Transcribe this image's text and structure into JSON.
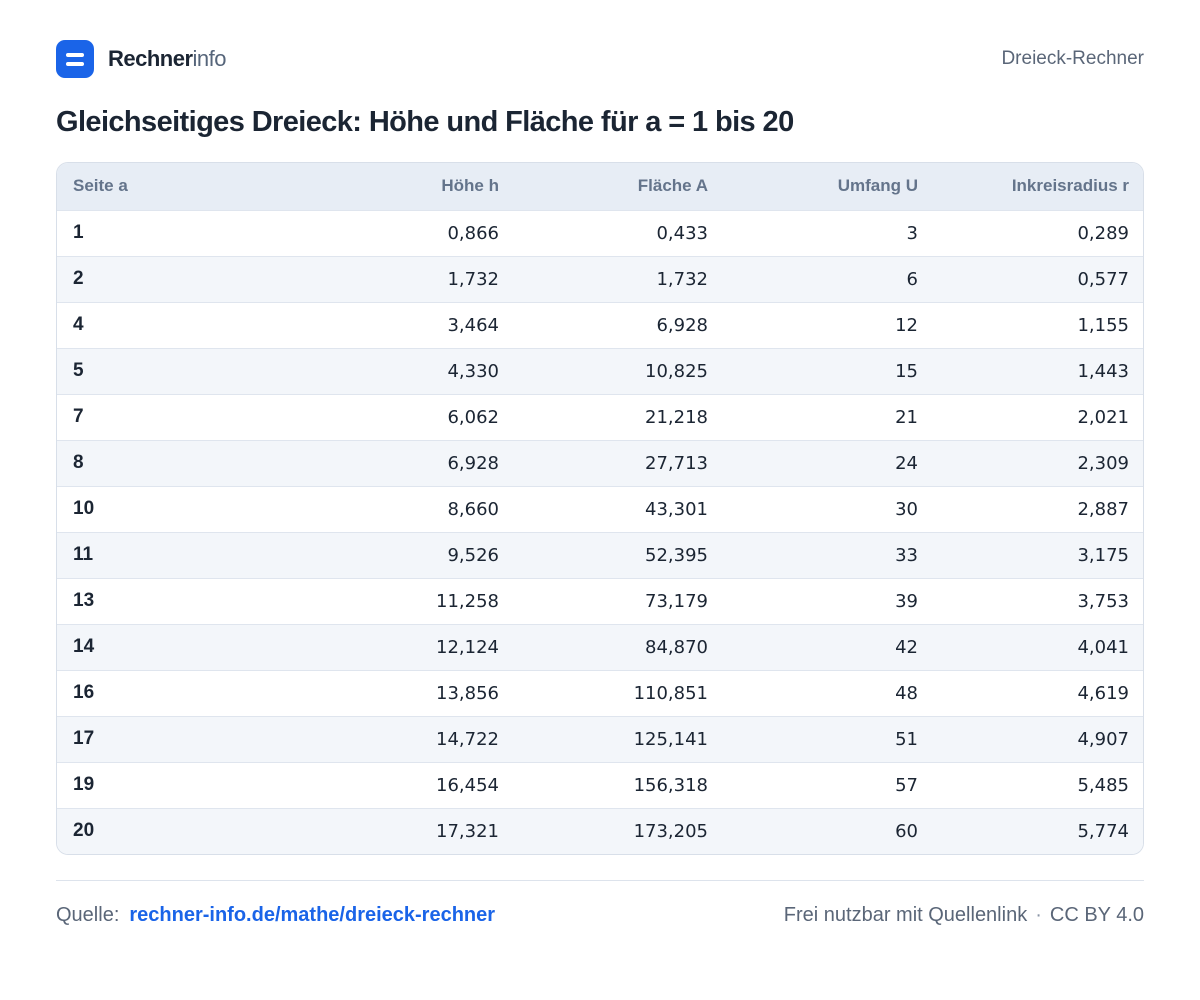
{
  "header": {
    "brand_strong": "Rechner",
    "brand_light": "info",
    "section": "Dreieck-Rechner"
  },
  "title": "Gleichseitiges Dreieck: Höhe und Fläche für a = 1 bis 20",
  "table": {
    "columns": [
      "Seite a",
      "Höhe h",
      "Fläche A",
      "Umfang U",
      "Inkreisradius r"
    ],
    "rows": [
      [
        "1",
        "0,866",
        "0,433",
        "3",
        "0,289"
      ],
      [
        "2",
        "1,732",
        "1,732",
        "6",
        "0,577"
      ],
      [
        "4",
        "3,464",
        "6,928",
        "12",
        "1,155"
      ],
      [
        "5",
        "4,330",
        "10,825",
        "15",
        "1,443"
      ],
      [
        "7",
        "6,062",
        "21,218",
        "21",
        "2,021"
      ],
      [
        "8",
        "6,928",
        "27,713",
        "24",
        "2,309"
      ],
      [
        "10",
        "8,660",
        "43,301",
        "30",
        "2,887"
      ],
      [
        "11",
        "9,526",
        "52,395",
        "33",
        "3,175"
      ],
      [
        "13",
        "11,258",
        "73,179",
        "39",
        "3,753"
      ],
      [
        "14",
        "12,124",
        "84,870",
        "42",
        "4,041"
      ],
      [
        "16",
        "13,856",
        "110,851",
        "48",
        "4,619"
      ],
      [
        "17",
        "14,722",
        "125,141",
        "51",
        "4,907"
      ],
      [
        "19",
        "16,454",
        "156,318",
        "57",
        "5,485"
      ],
      [
        "20",
        "17,321",
        "173,205",
        "60",
        "5,774"
      ]
    ]
  },
  "footer": {
    "source_label": "Quelle:",
    "source_link": "rechner-info.de/mathe/dreieck-rechner",
    "license_text": "Frei nutzbar mit Quellenlink",
    "separator": "·",
    "license": "CC BY 4.0"
  },
  "colors": {
    "accent": "#1a64e8",
    "header_bg": "#e7edf5",
    "row_alt": "#f3f6fa"
  }
}
